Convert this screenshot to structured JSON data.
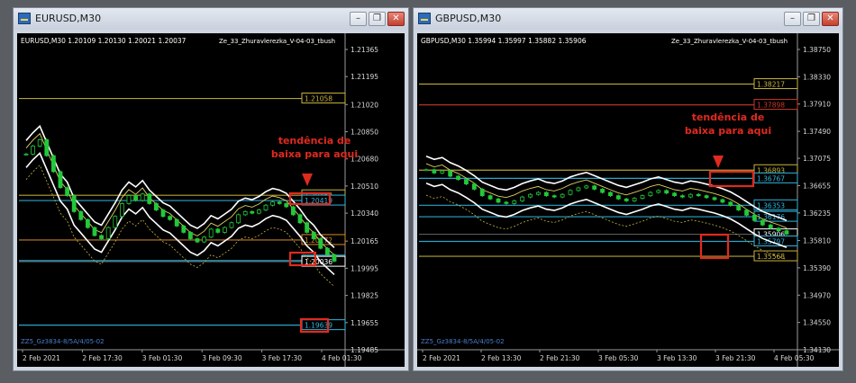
{
  "windows": [
    {
      "title": "EURUSD,M30",
      "header": "EURUSD,M30  1.20109 1.20130 1.20021 1.20037",
      "indicator": "Ze_33_Zhuravlerezka_V-04-03_tbush",
      "watermark": "ZZ5_Gz3834-8/5A/4/05-02",
      "annotation": [
        "tendência de",
        "baixa para aqui"
      ]
    },
    {
      "title": "GBPUSD,M30",
      "header": "GBPUSD,M30  1.35994 1.35997 1.35882 1.35906",
      "indicator": "Ze_33_Zhuravlerezka_V-04-03_tbush",
      "watermark": "ZZ5_Gz3834-8/5A/4/05-02",
      "annotation": [
        "tendência de",
        "baixa para aqui"
      ]
    }
  ],
  "chart_data": [
    {
      "type": "line",
      "symbol": "EURUSD",
      "timeframe": "M30",
      "ohlc": {
        "open": 1.20109,
        "high": 1.2013,
        "low": 1.20021,
        "close": 1.20037
      },
      "x_ticks": [
        "2 Feb 2021",
        "2 Feb 17:30",
        "3 Feb 01:30",
        "3 Feb 09:30",
        "3 Feb 17:30",
        "4 Feb 01:30"
      ],
      "y_ticks": [
        "1.21365",
        "1.21195",
        "1.21020",
        "1.20850",
        "1.20680",
        "1.20510",
        "1.20340",
        "1.20165",
        "1.19995",
        "1.19825",
        "1.19655",
        "1.19485"
      ],
      "ylim": [
        1.19485,
        1.21365
      ],
      "price_labels": [
        {
          "text": "1.21058",
          "value": 1.21058,
          "color": "#c8b43c"
        },
        {
          "text": "1.20452",
          "value": 1.20452,
          "color": "#c8b43c"
        },
        {
          "text": "1.20419",
          "value": 1.20419,
          "color": "#2fb7e0"
        },
        {
          "text": "1.20172",
          "value": 1.20172,
          "color": "#d88a2a"
        },
        {
          "text": "1.20043",
          "value": 1.20043,
          "color": "#2fb7e0"
        },
        {
          "text": "1.20036",
          "value": 1.20036,
          "color": "#ffffff"
        },
        {
          "text": "1.19639",
          "value": 1.19639,
          "color": "#2fb7e0"
        }
      ],
      "close_series": [
        1.2071,
        1.2076,
        1.208,
        1.207,
        1.206,
        1.205,
        1.2045,
        1.2035,
        1.203,
        1.2025,
        1.202,
        1.2018,
        1.2025,
        1.2032,
        1.204,
        1.2045,
        1.2042,
        1.2046,
        1.204,
        1.2036,
        1.2032,
        1.203,
        1.2026,
        1.2022,
        1.2018,
        1.2016,
        1.2019,
        1.2024,
        1.2022,
        1.2025,
        1.2028,
        1.2033,
        1.2035,
        1.2034,
        1.2036,
        1.2039,
        1.2041,
        1.204,
        1.2038,
        1.2033,
        1.2028,
        1.2022,
        1.2018,
        1.2012,
        1.2008,
        1.2004
      ]
    },
    {
      "type": "line",
      "symbol": "GBPUSD",
      "timeframe": "M30",
      "ohlc": {
        "open": 1.35994,
        "high": 1.35997,
        "low": 1.35882,
        "close": 1.35906
      },
      "x_ticks": [
        "2 Feb 2021",
        "2 Feb 13:30",
        "2 Feb 21:30",
        "3 Feb 05:30",
        "3 Feb 13:30",
        "3 Feb 21:30",
        "4 Feb 05:30"
      ],
      "y_ticks": [
        "1.38750",
        "1.38330",
        "1.37910",
        "1.37490",
        "1.37075",
        "1.36655",
        "1.36235",
        "1.35810",
        "1.35390",
        "1.34970",
        "1.34550",
        "1.34130"
      ],
      "ylim": [
        1.3413,
        1.3875
      ],
      "price_labels": [
        {
          "text": "1.38217",
          "value": 1.38217,
          "color": "#c8b43c"
        },
        {
          "text": "1.37898",
          "value": 1.37898,
          "color": "#c83a2a"
        },
        {
          "text": "1.36893",
          "value": 1.36893,
          "color": "#c8b43c"
        },
        {
          "text": "1.36767",
          "value": 1.36767,
          "color": "#2fb7e0"
        },
        {
          "text": "1.36353",
          "value": 1.36353,
          "color": "#2fb7e0"
        },
        {
          "text": "1.36176",
          "value": 1.36176,
          "color": "#2fb7e0"
        },
        {
          "text": "1.35906",
          "value": 1.35906,
          "color": "#ffffff"
        },
        {
          "text": "1.35797",
          "value": 1.35797,
          "color": "#2fb7e0"
        },
        {
          "text": "1.35568",
          "value": 1.35568,
          "color": "#c8b43c"
        }
      ],
      "close_series": [
        1.369,
        1.3685,
        1.3688,
        1.368,
        1.3675,
        1.3668,
        1.366,
        1.365,
        1.3645,
        1.364,
        1.3638,
        1.3642,
        1.3648,
        1.3652,
        1.3655,
        1.365,
        1.3648,
        1.3652,
        1.3658,
        1.3662,
        1.3665,
        1.366,
        1.3655,
        1.365,
        1.3645,
        1.3642,
        1.3646,
        1.365,
        1.3655,
        1.3658,
        1.3654,
        1.365,
        1.3648,
        1.3652,
        1.365,
        1.3647,
        1.3644,
        1.364,
        1.3635,
        1.3628,
        1.362,
        1.3612,
        1.3605,
        1.36,
        1.3596,
        1.3591
      ]
    }
  ]
}
